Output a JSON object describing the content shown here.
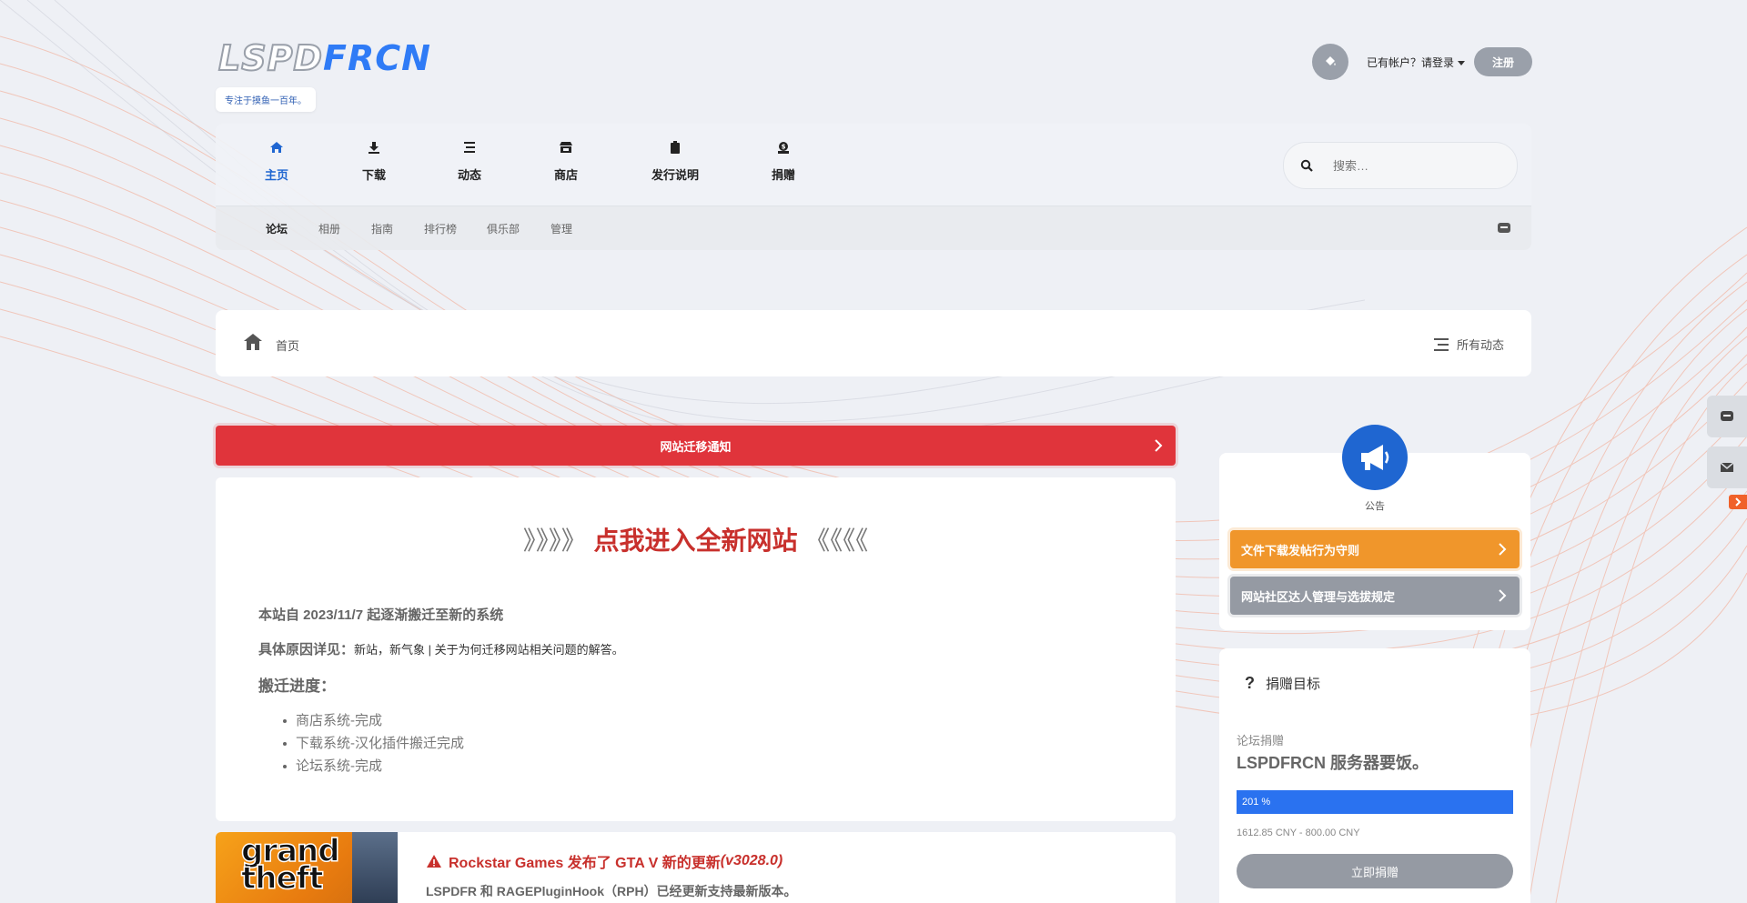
{
  "header": {
    "logo_part1": "LSPD",
    "logo_part2": "FRCN",
    "tagline": "专注于摸鱼一百年。",
    "login_text": "已有帐户？请登录",
    "register_label": "注册"
  },
  "nav": {
    "items": [
      {
        "label": "主页",
        "icon": "home-icon"
      },
      {
        "label": "下载",
        "icon": "download-icon"
      },
      {
        "label": "动态",
        "icon": "activity-icon"
      },
      {
        "label": "商店",
        "icon": "store-icon"
      },
      {
        "label": "发行说明",
        "icon": "clipboard-icon"
      },
      {
        "label": "捐赠",
        "icon": "donate-icon"
      }
    ],
    "search_placeholder": "搜索…"
  },
  "subnav": {
    "items": [
      "论坛",
      "相册",
      "指南",
      "排行榜",
      "俱乐部",
      "管理"
    ]
  },
  "breadcrumb": {
    "home": "首页",
    "all_activity": "所有动态"
  },
  "alert": {
    "label": "网站迁移通知"
  },
  "notice": {
    "link_left": "》》》》",
    "link_main": "点我进入全新网站",
    "link_right": "《《《《",
    "line1": "本站自 2023/11/7 起逐渐搬迁至新的系统",
    "reason_label": "具体原因详见：",
    "reason_link": "新站，新气象 | 关于为何迁移网站相关问题的解答。",
    "progress_label": "搬迁进度：",
    "progress_items": [
      "商店系统-完成",
      "下载系统-汉化插件搬迁完成",
      "论坛系统-完成"
    ]
  },
  "news": {
    "image_text": "grand theft",
    "title_main": "Rockstar Games 发布了 GTA V 新的更新 ",
    "title_version": "(v3028.0)",
    "subtitle": "LSPDFR 和 RAGEPluginHook（RPH）已经更新支持最新版本。"
  },
  "announce": {
    "label": "公告",
    "buttons": [
      "文件下载发帖行为守则",
      "网站社区达人管理与选拔规定"
    ]
  },
  "donate": {
    "heading": "捐赠目标",
    "sub": "论坛捐赠",
    "goal": "LSPDFRCN 服务器要饭。",
    "percent_label": "201 %",
    "progress_fraction": 1.0,
    "amount": "1612.85 CNY - 800.00 CNY",
    "button": "立即捐赠"
  },
  "colors": {
    "accent_blue": "#1f66d1",
    "alert_red": "#e0343b",
    "orange": "#f0962b",
    "gray_button": "#959aa3"
  }
}
